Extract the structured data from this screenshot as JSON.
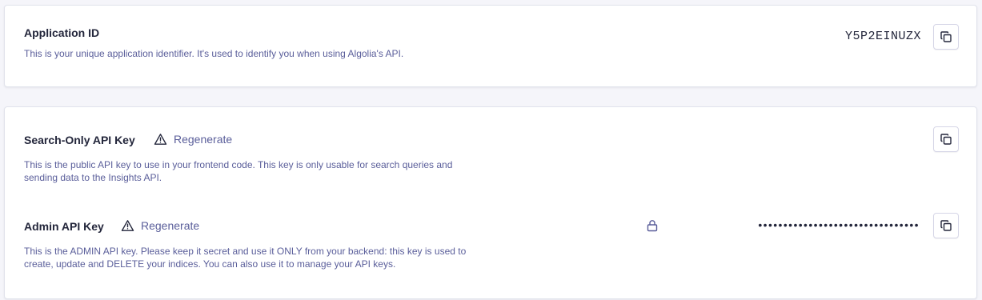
{
  "application": {
    "title": "Application ID",
    "description": "This is your unique application identifier. It's used to identify you when using Algolia's API.",
    "value": "Y5P2EINUZX",
    "copy_icon": "copy-icon"
  },
  "search_key": {
    "title": "Search-Only API Key",
    "regenerate_label": "Regenerate",
    "warning_icon": "warning-icon",
    "description_line1": "This is the public API key to use in your frontend code. This key is only usable for search queries and",
    "description_line2": "sending data to the Insights API.",
    "copy_icon": "copy-icon"
  },
  "admin_key": {
    "title": "Admin API Key",
    "regenerate_label": "Regenerate",
    "warning_icon": "warning-icon",
    "description_line1": "This is the ADMIN API key. Please keep it secret and use it ONLY from your backend: this key is used to",
    "description_line2": "create, update and DELETE your indices. You can also use it to manage your API keys.",
    "masked_value": "••••••••••••••••••••••••••••••••",
    "lock_icon": "lock-icon",
    "copy_icon": "copy-icon"
  },
  "colors": {
    "text_primary": "#23263b",
    "text_secondary": "#5a5e9a",
    "border": "#d6d6e7",
    "background": "#f5f5fa"
  }
}
